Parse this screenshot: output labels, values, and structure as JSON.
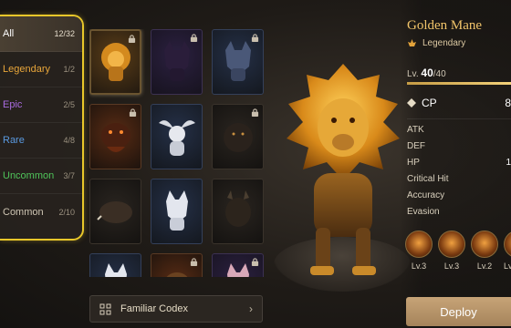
{
  "filters": [
    {
      "label": "All",
      "count": "12/32",
      "color": "#ffffff"
    },
    {
      "label": "Legendary",
      "count": "1/2",
      "color": "#e8a63a"
    },
    {
      "label": "Epic",
      "count": "2/5",
      "color": "#a86be0"
    },
    {
      "label": "Rare",
      "count": "4/8",
      "color": "#5a9ae0"
    },
    {
      "label": "Uncommon",
      "count": "3/7",
      "color": "#4fc45a"
    },
    {
      "label": "Common",
      "count": "2/10",
      "color": "#cfc6b4"
    }
  ],
  "grid": {
    "cells": [
      {
        "creature": "golden-lion",
        "rarity": "legendary",
        "locked": true,
        "selected": true
      },
      {
        "creature": "shadow-wolf",
        "rarity": "epic",
        "locked": true
      },
      {
        "creature": "frost-wolf",
        "rarity": "rare",
        "locked": true
      },
      {
        "creature": "fire-boar",
        "rarity": "fire",
        "locked": true
      },
      {
        "creature": "white-griffin",
        "rarity": "rare",
        "locked": false
      },
      {
        "creature": "dark-beast",
        "rarity": "dark",
        "locked": true
      },
      {
        "creature": "wild-boar",
        "rarity": "dark",
        "locked": false
      },
      {
        "creature": "white-fox",
        "rarity": "rare",
        "locked": false
      },
      {
        "creature": "horned-beast",
        "rarity": "dark",
        "locked": false
      },
      {
        "creature": "white-cat",
        "rarity": "rare",
        "locked": false
      },
      {
        "creature": "golden-hound",
        "rarity": "fire",
        "locked": true
      },
      {
        "creature": "pink-cat",
        "rarity": "epic",
        "locked": true
      }
    ]
  },
  "codex": {
    "label": "Familiar Codex",
    "icon": "codex-icon"
  },
  "detail": {
    "name": "Golden Mane",
    "rarity": "Legendary",
    "level_prefix": "Lv. ",
    "level_current": "40",
    "level_max": "/40",
    "xp_fraction": 1.0,
    "cp_label": "CP",
    "cp_value": "8",
    "stats": [
      {
        "label": "ATK",
        "value": ""
      },
      {
        "label": "DEF",
        "value": ""
      },
      {
        "label": "HP",
        "value": "1"
      },
      {
        "label": "Critical Hit",
        "value": ""
      },
      {
        "label": "Accuracy",
        "value": ""
      },
      {
        "label": "Evasion",
        "value": ""
      }
    ],
    "skills": [
      {
        "icon": "claw-skill-icon",
        "level": "Lv.3"
      },
      {
        "icon": "roar-skill-icon",
        "level": "Lv.3"
      },
      {
        "icon": "slash-skill-icon",
        "level": "Lv.2"
      },
      {
        "icon": "flame-skill-icon",
        "level": "Lv"
      }
    ],
    "deploy_label": "Deploy"
  },
  "colors": {
    "accent": "#e8c72a",
    "gold": "#f1c46a",
    "deploy": "#b8946a"
  }
}
